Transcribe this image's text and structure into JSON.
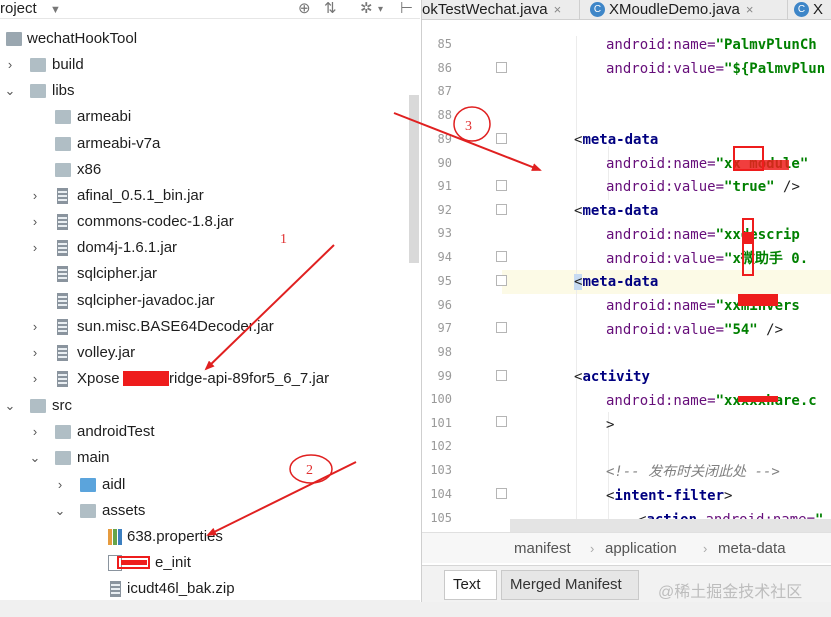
{
  "project_panel": {
    "title": "roject",
    "tree": [
      {
        "label": "wechatHookTool",
        "icon": "project-icon",
        "expanded": true
      },
      {
        "label": "build",
        "icon": "folder-icon",
        "expanded": false
      },
      {
        "label": "libs",
        "icon": "folder-icon",
        "expanded": true
      },
      {
        "label": "armeabi",
        "icon": "folder-icon"
      },
      {
        "label": "armeabi-v7a",
        "icon": "folder-icon"
      },
      {
        "label": "x86",
        "icon": "folder-icon"
      },
      {
        "label": "afinal_0.5.1_bin.jar",
        "icon": "jar-icon"
      },
      {
        "label": "commons-codec-1.8.jar",
        "icon": "jar-icon"
      },
      {
        "label": "dom4j-1.6.1.jar",
        "icon": "jar-icon"
      },
      {
        "label": "sqlcipher.jar",
        "icon": "jar-icon"
      },
      {
        "label": "sqlcipher-javadoc.jar",
        "icon": "jar-icon"
      },
      {
        "label": "sun.misc.BASE64Decoder.jar",
        "icon": "jar-icon"
      },
      {
        "label": "volley.jar",
        "icon": "jar-icon"
      },
      {
        "label": "Xpose",
        "label_tail": "ridge-api-89for5_6_7.jar",
        "icon": "jar-icon"
      },
      {
        "label": "src",
        "icon": "folder-icon",
        "expanded": true
      },
      {
        "label": "androidTest",
        "icon": "folder-icon"
      },
      {
        "label": "main",
        "icon": "folder-icon",
        "expanded": true
      },
      {
        "label": "aidl",
        "icon": "folder-blue-icon"
      },
      {
        "label": "assets",
        "icon": "folder-resources-icon",
        "expanded": true
      },
      {
        "label": "638.properties",
        "icon": "properties-icon"
      },
      {
        "label": "e_init",
        "icon": "file-icon"
      },
      {
        "label": "icudt46l_bak.zip",
        "icon": "jar-icon"
      }
    ]
  },
  "editor": {
    "tabs": [
      {
        "label": "okTestWechat.java",
        "icon": "class-icon"
      },
      {
        "label": "XMoudleDemo.java",
        "icon": "class-icon"
      },
      {
        "label": "X",
        "icon": "class-icon"
      }
    ],
    "line_numbers": [
      "85",
      "86",
      "87",
      "88",
      "89",
      "90",
      "91",
      "92",
      "93",
      "94",
      "95",
      "96",
      "97",
      "98",
      "99",
      "100",
      "101",
      "102",
      "103",
      "104",
      "105"
    ],
    "lines": {
      "l85_attr": "android:name=",
      "l85_val": "\"PalmvPlunCh",
      "l86_attr": "android:value=",
      "l86_val": "\"${PalmvPlun",
      "l89_tag": "meta-data",
      "l90_attr": "android:name=",
      "l90_val": "\"xx module\"",
      "l91_attr": "android:value=",
      "l91_val": "\"true\"",
      "l91_end": " />",
      "l92_tag": "meta-data",
      "l93_attr": "android:name=",
      "l93_val": "\"xxdescrip",
      "l94_attr": "android:value=",
      "l94_val": "\"x微助手 0.",
      "l95_tag": "meta-data",
      "l96_attr": "android:name=",
      "l96_val": "\"xxminvers",
      "l97_attr": "android:value=",
      "l97_val": "\"54\"",
      "l97_end": " />",
      "l99_tag": "activity",
      "l100_attr": "android:name=",
      "l100_val": "\"xxxxxhare.c",
      "l101_close": ">",
      "l103_cmt": "<!-- 发布时关闭此处 -->",
      "l104_tag": "intent-filter",
      "l105_tag": "action",
      "l105_attr": "android:name=",
      "l105_val": "\""
    },
    "breadcrumb": [
      "manifest",
      "application",
      "meta-data"
    ],
    "bottom_tabs": [
      "Text",
      "Merged Manifest"
    ],
    "watermark": "@稀土掘金技术社区"
  },
  "annotations": {
    "labels": [
      "1",
      "2",
      "3"
    ],
    "color": "#e02020"
  },
  "colors": {
    "tag": "#000080",
    "attribute": "#660e7a",
    "string_value": "#008000",
    "comment": "#808080",
    "current_line": "#fcfae6",
    "redaction": "#ee1c1c"
  }
}
